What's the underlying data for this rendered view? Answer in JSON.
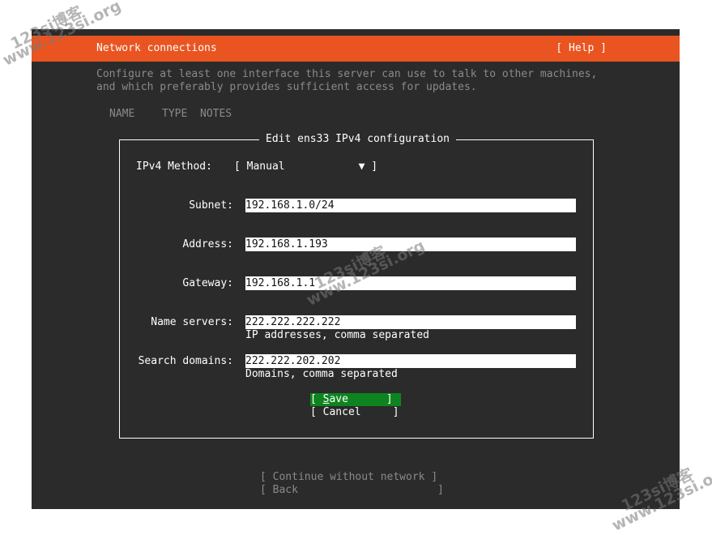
{
  "header": {
    "title": "Network connections",
    "help": "[ Help ]"
  },
  "description": {
    "line1": "Configure at least one interface this server can use to talk to other machines,",
    "line2": "and which preferably provides sufficient access for updates."
  },
  "table": {
    "columns": [
      "NAME",
      "TYPE",
      "NOTES"
    ]
  },
  "dialog": {
    "title": "Edit ens33 IPv4 configuration",
    "method": {
      "label": "IPv4 Method:",
      "open": "[ ",
      "value": "Manual",
      "arrow": "▼",
      "close": " ]"
    },
    "subnet": {
      "label": "Subnet:",
      "value": "192.168.1.0/24"
    },
    "address": {
      "label": "Address:",
      "value": "192.168.1.193"
    },
    "gateway": {
      "label": "Gateway:",
      "value": "192.168.1.1"
    },
    "name_servers": {
      "label": "Name servers:",
      "value": "222.222.222.222",
      "hint": "IP addresses, comma separated"
    },
    "search_domains": {
      "label": "Search domains:",
      "value": "222.222.202.202",
      "hint": "Domains, comma separated"
    },
    "save": {
      "open": "[ ",
      "hotkey": "S",
      "rest": "ave",
      "close": "      ]"
    },
    "cancel": {
      "label": "[ Cancel     ]"
    }
  },
  "footer": {
    "continue": "[ Continue without network ]",
    "back": "[ Back                      ]"
  },
  "watermark": {
    "cn": "123si博客",
    "url": "www.123si.org"
  },
  "colors": {
    "header_bg": "#e95420",
    "terminal_bg": "#2b2b2b",
    "save_bg": "#0e8420"
  }
}
